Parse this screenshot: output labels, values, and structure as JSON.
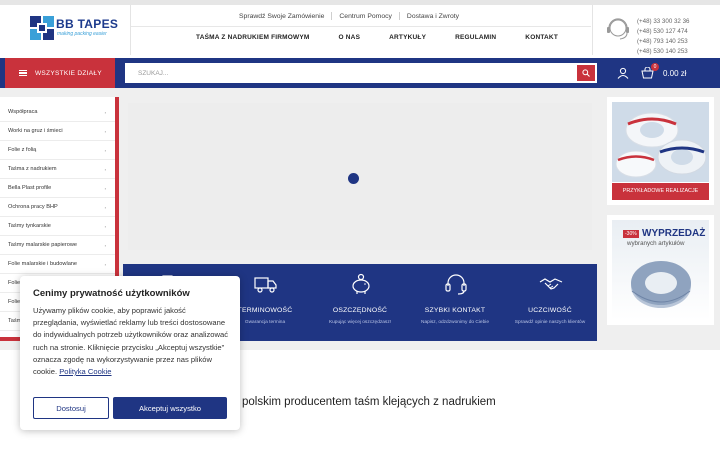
{
  "brand": {
    "name": "BB TAPES",
    "tagline": "making packing easier"
  },
  "top_links": [
    "Sprawdź Swoje Zamówienie",
    "Centrum Pomocy",
    "Dostawa i Zwroty"
  ],
  "main_nav": [
    "TAŚMA Z NADRUKIEM FIRMOWYM",
    "O NAS",
    "ARTYKUŁY",
    "REGULAMIN",
    "KONTAKT"
  ],
  "phones": [
    "(+48) 33 300 32 36",
    "(+48) 530 127 474",
    "(+48) 793 140 253",
    "(+48) 530 140 253"
  ],
  "departments_label": "WSZYSTKIE DZIAŁY",
  "search": {
    "placeholder": "SZUKAJ...",
    "value": ""
  },
  "cart": {
    "count": "0",
    "total": "0.00 zł"
  },
  "sidebar": {
    "items": [
      {
        "label": "Współpraca"
      },
      {
        "label": "Worki na gruz i śmieci"
      },
      {
        "label": "Folie z folią"
      },
      {
        "label": "Taśma z nadrukiem"
      },
      {
        "label": "Bella Plast profile"
      },
      {
        "label": "Ochrona pracy BHP"
      },
      {
        "label": "Taśmy tynkarskie"
      },
      {
        "label": "Taśmy malarskie papierowe"
      },
      {
        "label": "Folie malarskie i budowlane"
      },
      {
        "label": "Folie"
      },
      {
        "label": "Folie"
      },
      {
        "label": "Taśm"
      }
    ],
    "chevron": "›"
  },
  "banners": {
    "realizations": "PRZYKŁADOWE REALIZACJE",
    "sale_badge": "-30%",
    "sale_title": "WYPRZEDAŻ",
    "sale_sub": "wybranych artykułów"
  },
  "features": [
    {
      "title": "",
      "sub": "",
      "icon": "tag-icon"
    },
    {
      "title": "TERMINOWOŚĆ",
      "sub": "Gwarancja termina",
      "icon": "truck-icon"
    },
    {
      "title": "OSZCZĘDNOŚĆ",
      "sub": "Kupując więcej oszczędzasz!",
      "icon": "piggy-bank-icon"
    },
    {
      "title": "SZYBKI KONTAKT",
      "sub": "Napisz, odzdzwonimy do Ciebie",
      "icon": "headset-icon"
    },
    {
      "title": "UCZCIWOŚĆ",
      "sub": "Sprawdź opinie naszych klientów",
      "icon": "handshake-icon"
    }
  ],
  "heading": "polskim producentem taśm klejących z nadrukiem",
  "cookie": {
    "title": "Cenimy prywatność użytkowników",
    "text": "Używamy plików cookie, aby poprawić jakość przeglądania, wyświetlać reklamy lub treści dostosowane do indywidualnych potrzeb użytkowników oraz analizować ruch na stronie. Kliknięcie przycisku „Akceptuj wszystkie” oznacza zgodę na wykorzystywanie przez nas plików cookie.",
    "link": "Polityka Cookie",
    "reject": "Dostosuj",
    "accept": "Akceptuj wszystko"
  },
  "colors": {
    "navy": "#1f3583",
    "red": "#c9323c",
    "light_blue": "#3aa0d8"
  }
}
